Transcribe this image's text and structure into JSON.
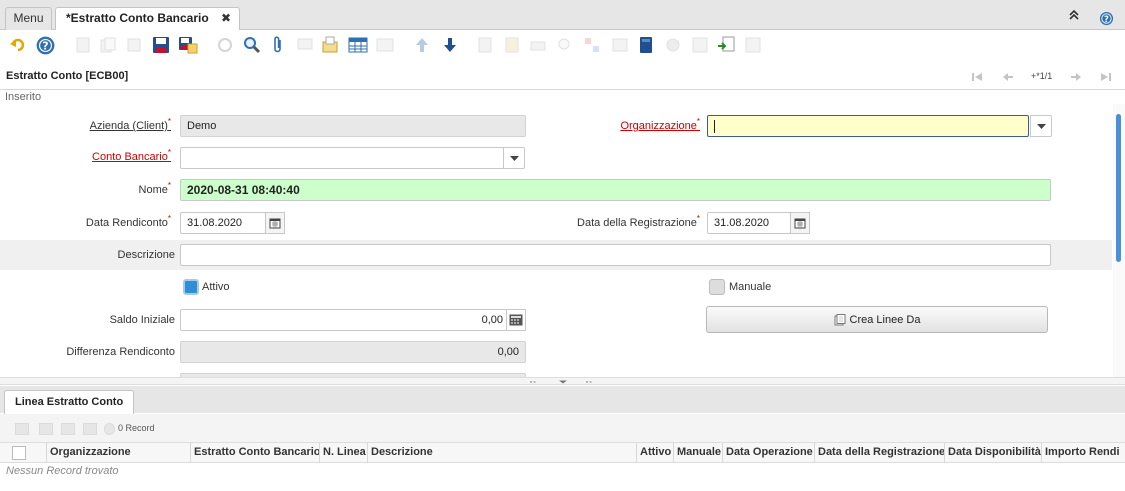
{
  "tabs": {
    "menu_label": "Menu",
    "active_label": "*Estratto Conto Bancario [E...",
    "close_glyph": "✖"
  },
  "header": {
    "title": "Estratto Conto [ECB00]",
    "record_nav": "+*1/1",
    "status": "Inserito"
  },
  "form": {
    "azienda_label": "Azienda (Client)",
    "azienda_value": "Demo",
    "organizzazione_label": "Organizzazione",
    "organizzazione_value": "",
    "conto_label": "Conto Bancario",
    "conto_value": "",
    "nome_label": "Nome",
    "nome_value": "2020-08-31 08:40:40",
    "data_rendiconto_label": "Data Rendiconto",
    "data_rendiconto_value": "31.08.2020",
    "data_registrazione_label": "Data della Registrazione",
    "data_registrazione_value": "31.08.2020",
    "descrizione_label": "Descrizione",
    "descrizione_value": "",
    "attivo_label": "Attivo",
    "attivo_checked": true,
    "manuale_label": "Manuale",
    "manuale_checked": false,
    "saldo_label": "Saldo Iniziale",
    "saldo_value": "0,00",
    "crea_button": "Crea Linee Da",
    "differenza_label": "Differenza Rendiconto",
    "differenza_value": "0,00",
    "required_mark": "*"
  },
  "detail": {
    "tab_label": "Linea Estratto Conto",
    "record_count": "0 Record",
    "columns": [
      "Organizzazione",
      "Estratto Conto Bancario",
      "N. Linea",
      "Descrizione",
      "Attivo",
      "Manuale",
      "Data Operazione",
      "Data della Registrazione",
      "Data Disponibilità",
      "Importo Rendi"
    ],
    "empty_text": "Nessun Record trovato"
  },
  "colors": {
    "required": "#cc0000",
    "accent": "#2f6fb3",
    "mandatory_filled": "#ccffcc",
    "focus_field": "#ffffcc"
  }
}
